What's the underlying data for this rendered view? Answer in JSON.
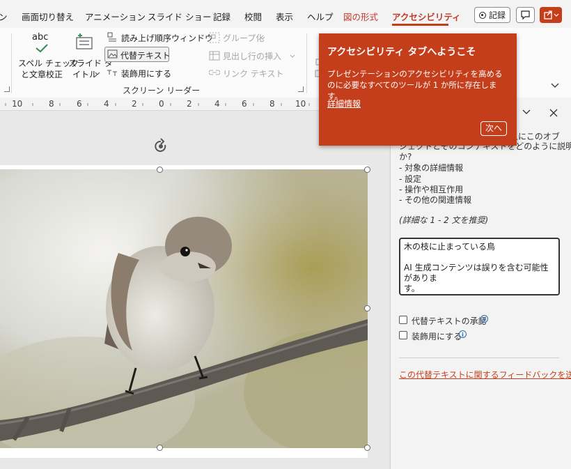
{
  "tabs": [
    "画面切り替え",
    "アニメーション",
    "スライド ショー",
    "記録",
    "校閲",
    "表示",
    "ヘルプ",
    "図の形式",
    "アクセシビリティ"
  ],
  "partial_tab": "ン",
  "record_label": "記録",
  "ribbon": {
    "spell_icon_text": "abc",
    "spell_label_1": "スペル チェック",
    "spell_label_2": "と文章校正",
    "slide_title_1": "スライド タ",
    "slide_title_2": "イトル",
    "reading_order": "読み上げ順序ウィンドウ",
    "alt_text": "代替テキスト",
    "decorative": "装飾用にする",
    "group": "グループ化",
    "header_row": "見出し行の挿入",
    "link_text": "リンク テキスト",
    "group_label": "スクリーン リーダー"
  },
  "ruler_labels": [
    "10",
    "8",
    "6",
    "4",
    "2",
    "0",
    "2",
    "4",
    "6",
    "8",
    "10"
  ],
  "pane": {
    "intro_1": "人にこのオブ",
    "intro_2": "ジェクトとそのコンテキストをどのように説明します",
    "intro_3": "か?",
    "bullets": [
      "- 対象の詳細情報",
      "- 設定",
      "- 操作や相互作用",
      "- その他の関連情報"
    ],
    "recommend": "(詳細な 1 - 2 文を推奨)",
    "alt_value_1": "木の枝に止まっている鳥",
    "alt_value_2": "AI 生成コンテンツは誤りを含む可能性がありま",
    "alt_value_3": "す。",
    "approve_label": "代替テキストの承認",
    "decorative_label": "装飾用にする",
    "feedback_link": "この代替テキストに関するフィードバックを送信する"
  },
  "callout": {
    "title": "アクセシビリティ タブへようこそ",
    "body": "プレゼンテーションのアクセシビリティを高めるのに必要なすべてのツールが 1 か所に存在します。",
    "link": "詳細情報",
    "next": "次へ"
  },
  "colors": {
    "accent": "#c43e1c",
    "ribbon_bg": "#fbfbfb",
    "pane_bg": "#f3f3f3"
  }
}
